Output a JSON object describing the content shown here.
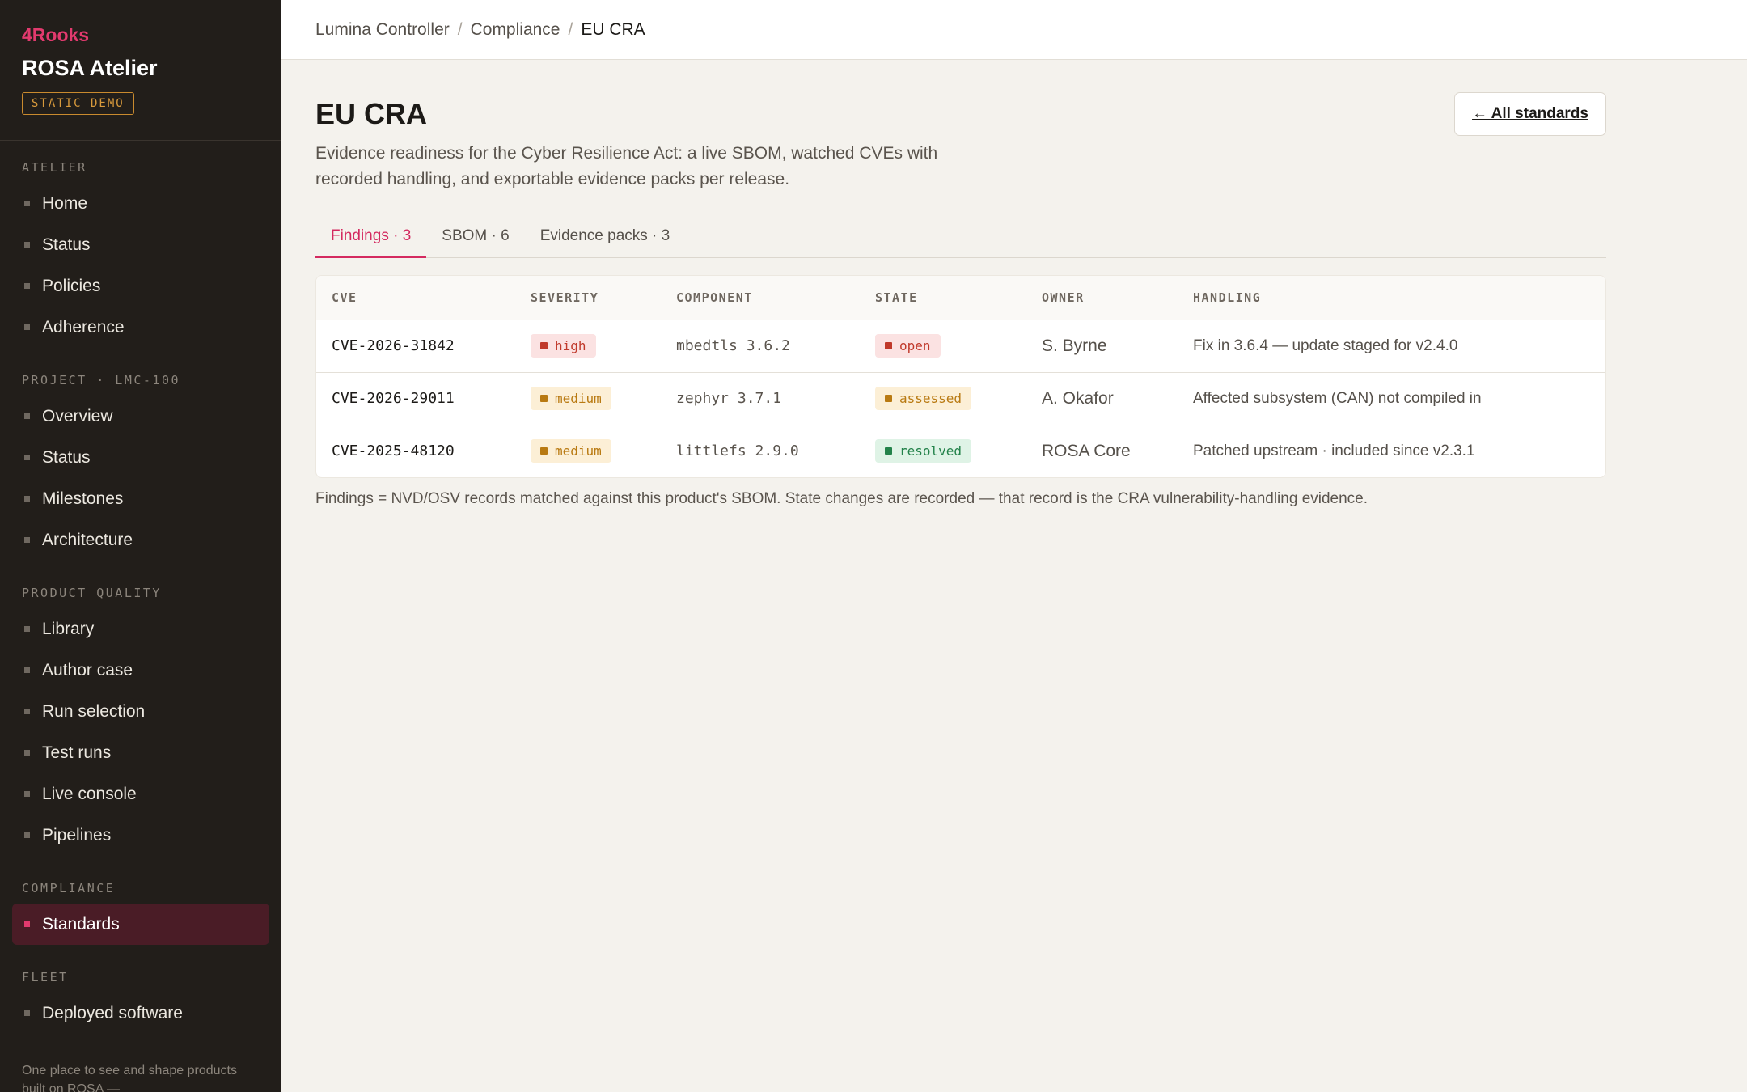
{
  "brand": {
    "org": "4Rooks",
    "name": "ROSA Atelier",
    "badge": "STATIC DEMO"
  },
  "nav": {
    "atelier": {
      "title": "ATELIER",
      "items": [
        "Home",
        "Status",
        "Policies",
        "Adherence"
      ]
    },
    "project": {
      "title": "PROJECT · LMC-100",
      "items": [
        "Overview",
        "Status",
        "Milestones",
        "Architecture"
      ]
    },
    "quality": {
      "title": "PRODUCT QUALITY",
      "items": [
        "Library",
        "Author case",
        "Run selection",
        "Test runs",
        "Live console",
        "Pipelines"
      ]
    },
    "compliance": {
      "title": "COMPLIANCE",
      "items": [
        "Standards"
      ]
    },
    "fleet": {
      "title": "FLEET",
      "items": [
        "Deployed software"
      ]
    }
  },
  "sidebar_footer": "One place to see and shape products built on ROSA —",
  "breadcrumb": [
    "Lumina Controller",
    "Compliance",
    "EU CRA"
  ],
  "page": {
    "title": "EU CRA",
    "description": "Evidence readiness for the Cyber Resilience Act: a live SBOM, watched CVEs with recorded handling, and exportable evidence packs per release.",
    "back_label": "← All standards"
  },
  "tabs": [
    "Findings · 3",
    "SBOM · 6",
    "Evidence packs · 3"
  ],
  "table": {
    "headers": [
      "CVE",
      "SEVERITY",
      "COMPONENT",
      "STATE",
      "OWNER",
      "HANDLING"
    ],
    "rows": [
      {
        "cve": "CVE-2026-31842",
        "severity": "high",
        "component": "mbedtls 3.6.2",
        "state": "open",
        "owner": "S. Byrne",
        "handling": "Fix in 3.6.4 — update staged for v2.4.0"
      },
      {
        "cve": "CVE-2026-29011",
        "severity": "medium",
        "component": "zephyr 3.7.1",
        "state": "assessed",
        "owner": "A. Okafor",
        "handling": "Affected subsystem (CAN) not compiled in"
      },
      {
        "cve": "CVE-2025-48120",
        "severity": "medium",
        "component": "littlefs 2.9.0",
        "state": "resolved",
        "owner": "ROSA Core",
        "handling": "Patched upstream · included since v2.3.1"
      }
    ]
  },
  "footnote": "Findings = NVD/OSV records matched against this product's SBOM. State changes are recorded — that record is the CRA vulnerability-handling evidence.",
  "colors": {
    "accent": "#d42a60",
    "sidebar_bg": "#221e1a",
    "high": "#c0392b",
    "medium": "#b97a12",
    "resolved": "#23824a"
  }
}
